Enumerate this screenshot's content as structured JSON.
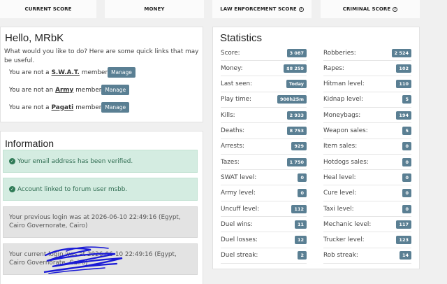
{
  "topbar": {
    "items": [
      {
        "label": "CURRENT SCORE",
        "help": false
      },
      {
        "label": "MONEY",
        "help": false
      },
      {
        "label": "LAW ENFORCEMENT SCORE",
        "help": true
      },
      {
        "label": "CRIMINAL SCORE",
        "help": true
      }
    ]
  },
  "hello": {
    "title": "Hello, MRbK",
    "intro": "What would you like to do? Here are some quick links that may be useful.",
    "manage_label": "Manage",
    "memberships": [
      {
        "prefix": "You are not a",
        "group": "S.W.A.T.",
        "suffix": "member"
      },
      {
        "prefix": "You are not an",
        "group": "Army",
        "suffix": "member"
      },
      {
        "prefix": "You are not a",
        "group": "Pagati",
        "suffix": "member"
      }
    ]
  },
  "information": {
    "title": "Information",
    "alerts": [
      {
        "type": "success",
        "text": "Your email address has been verified."
      },
      {
        "type": "success",
        "text": "Account linked to forum user msbb."
      },
      {
        "type": "info",
        "text": "Your previous login was at 2026-06-10 22:49:16 (Egypt, Cairo Governorate, Cairo)"
      },
      {
        "type": "info",
        "text": "Your current login was at 2026-06-10 22:49:16 (Egypt, Cairo Governorate, Cairo)"
      }
    ]
  },
  "statistics": {
    "title": "Statistics",
    "left": [
      {
        "label": "Score:",
        "value": "3 087"
      },
      {
        "label": "Money:",
        "value": "$8 259"
      },
      {
        "label": "Last seen:",
        "value": "Today"
      },
      {
        "label": "Play time:",
        "value": "900h25m"
      },
      {
        "label": "Kills:",
        "value": "2 933"
      },
      {
        "label": "Deaths:",
        "value": "8 753"
      },
      {
        "label": "Arrests:",
        "value": "929"
      },
      {
        "label": "Tazes:",
        "value": "1 750"
      },
      {
        "label": "SWAT level:",
        "value": "0"
      },
      {
        "label": "Army level:",
        "value": "0"
      },
      {
        "label": "Uncuff level:",
        "value": "112"
      },
      {
        "label": "Duel wins:",
        "value": "11"
      },
      {
        "label": "Duel losses:",
        "value": "12"
      },
      {
        "label": "Duel streak:",
        "value": "2"
      }
    ],
    "right": [
      {
        "label": "Robberies:",
        "value": "2 524"
      },
      {
        "label": "Rapes:",
        "value": "102"
      },
      {
        "label": "Hitman level:",
        "value": "110"
      },
      {
        "label": "Kidnap level:",
        "value": "5"
      },
      {
        "label": "Moneybags:",
        "value": "194"
      },
      {
        "label": "Weapon sales:",
        "value": "5"
      },
      {
        "label": "Item sales:",
        "value": "0"
      },
      {
        "label": "Hotdogs sales:",
        "value": "0"
      },
      {
        "label": "Heal level:",
        "value": "0"
      },
      {
        "label": "Cure level:",
        "value": "0"
      },
      {
        "label": "Taxi level:",
        "value": "0"
      },
      {
        "label": "Mechanic level:",
        "value": "117"
      },
      {
        "label": "Trucker level:",
        "value": "123"
      },
      {
        "label": "Rob streak:",
        "value": "14"
      }
    ]
  },
  "colors": {
    "badge": "#5a7f93",
    "success_bg": "#d4ece1",
    "info_bg": "#e3e3e3",
    "scribble": "#1a1ad6"
  }
}
